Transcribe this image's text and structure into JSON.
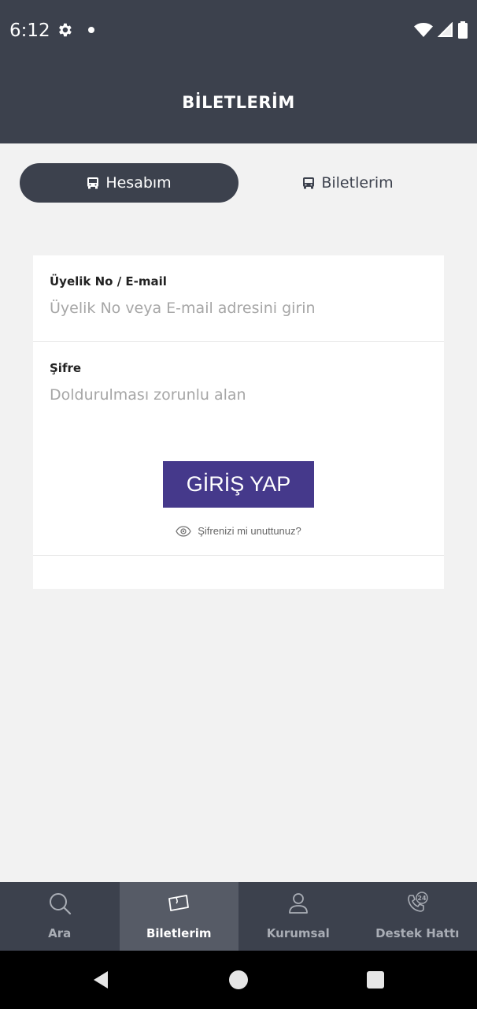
{
  "status_bar": {
    "time": "6:12",
    "icons": [
      "gear-icon",
      "notification-dot-icon",
      "wifi-icon",
      "signal-icon",
      "battery-icon"
    ]
  },
  "header": {
    "title": "BİLETLERİM",
    "background": "#3c414d"
  },
  "tabs": [
    {
      "label": "Hesabım",
      "icon": "bus-icon",
      "active": true
    },
    {
      "label": "Biletlerim",
      "icon": "bus-icon",
      "active": false
    }
  ],
  "login_form": {
    "member_field": {
      "label": "Üyelik No / E-mail",
      "placeholder": "Üyelik No veya E-mail adresini girin",
      "value": ""
    },
    "password_field": {
      "label": "Şifre",
      "placeholder": "Doldurulması zorunlu alan",
      "value": ""
    },
    "login_button_label": "GİRİŞ YAP",
    "login_button_color": "#45398b",
    "forgot_password_text": "Şifrenizi mi unuttunuz?"
  },
  "bottom_nav": {
    "items": [
      {
        "label": "Ara",
        "icon": "search-icon",
        "active": false
      },
      {
        "label": "Biletlerim",
        "icon": "ticket-icon",
        "active": true
      },
      {
        "label": "Kurumsal",
        "icon": "user-icon",
        "active": false
      },
      {
        "label": "Destek Hattı",
        "icon": "support-phone-icon",
        "active": false
      }
    ]
  },
  "system_nav": {
    "icons": [
      "back-icon",
      "home-icon",
      "recents-icon"
    ]
  }
}
